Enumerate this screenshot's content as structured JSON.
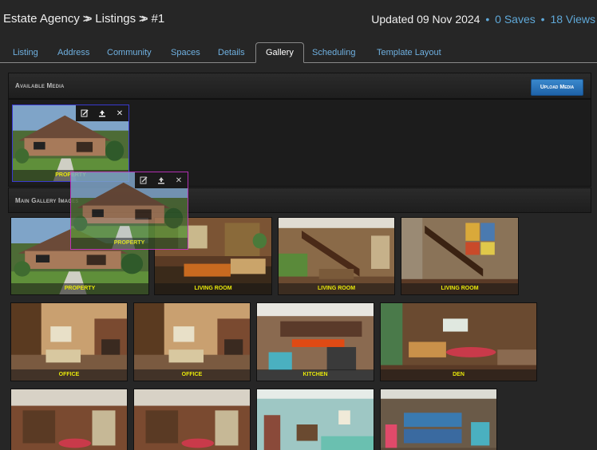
{
  "header": {
    "breadcrumb": [
      "Estate Agency",
      "Listings",
      "#1"
    ],
    "updated": "Updated 09 Nov 2024",
    "saves": "0 Saves",
    "views": "18 Views"
  },
  "tabs": [
    "Listing",
    "Address",
    "Community",
    "Spaces",
    "Details",
    "Gallery",
    "Scheduling",
    "Template Layout"
  ],
  "active_tab": "Gallery",
  "available_media": {
    "title": "Available Media",
    "upload_label": "Upload Media",
    "items": [
      {
        "caption": "PROPERTY"
      }
    ]
  },
  "dragging_item": {
    "caption": "PROPERTY"
  },
  "main_gallery": {
    "title": "Main Gallery Images",
    "items": [
      {
        "caption": "PROPERTY"
      },
      {
        "caption": "LIVING ROOM"
      },
      {
        "caption": "LIVING ROOM"
      },
      {
        "caption": "LIVING ROOM"
      },
      {
        "caption": "OFFICE"
      },
      {
        "caption": "OFFICE"
      },
      {
        "caption": "KITCHEN"
      },
      {
        "caption": "DEN"
      },
      {
        "caption": ""
      },
      {
        "caption": ""
      },
      {
        "caption": ""
      },
      {
        "caption": ""
      }
    ]
  },
  "colors": {
    "link": "#5fa8d8",
    "caption": "#e8e80a",
    "upload_button": "#2a76bc",
    "selected_border": "#3a3acf",
    "drag_border": "#cc33cc"
  }
}
